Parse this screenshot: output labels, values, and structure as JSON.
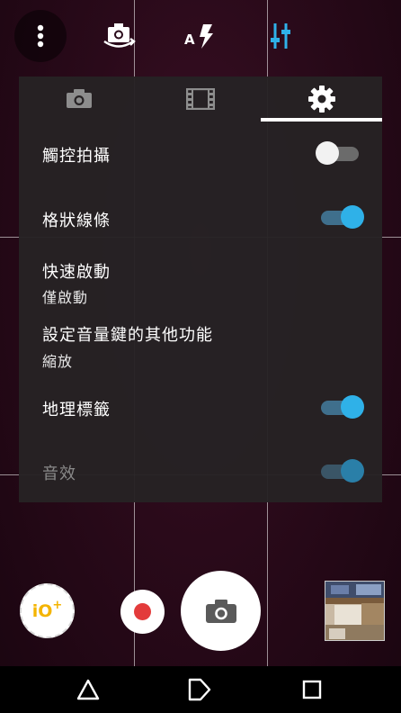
{
  "topbar": {
    "icons": [
      "more-vert-icon",
      "switch-camera-icon",
      "flash-auto-icon",
      "sliders-icon"
    ],
    "active_color": "#2fb1e8"
  },
  "tabs": [
    {
      "icon": "camera-icon",
      "active": false
    },
    {
      "icon": "film-icon",
      "active": false
    },
    {
      "icon": "gear-icon",
      "active": true
    }
  ],
  "settings": {
    "touch_capture": {
      "label": "觸控拍攝",
      "enabled": false
    },
    "grid_lines": {
      "label": "格狀線條",
      "enabled": true
    },
    "quick_launch": {
      "label": "快速啟動",
      "value": "僅啟動"
    },
    "volume_key": {
      "label": "設定音量鍵的其他功能",
      "value": "縮放"
    },
    "geotag": {
      "label": "地理標籤",
      "enabled": true
    },
    "sound": {
      "label": "音效",
      "enabled": true,
      "disabled": true
    }
  },
  "controls": {
    "mode_label": "iO",
    "record_color": "#e33b3b"
  },
  "nav": [
    "back-icon",
    "home-icon",
    "recents-icon"
  ]
}
